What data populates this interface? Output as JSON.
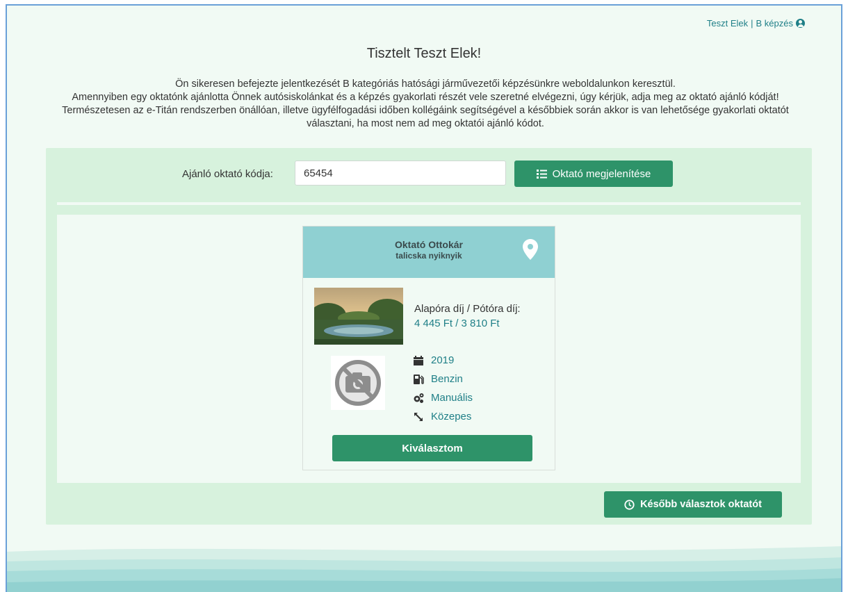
{
  "header": {
    "user_name": "Teszt Elek",
    "separator": "|",
    "course": "B képzés",
    "icon": "user-circle-icon"
  },
  "greeting": "Tisztelt Teszt Elek!",
  "intro": {
    "line1": "Ön sikeresen befejezte jelentkezését B kategóriás hatósági járművezetői képzésünkre weboldalunkon keresztül.",
    "line2": "Amennyiben egy oktatónk ajánlotta Önnek autósiskolánkat és a képzés gyakorlati részét vele szeretné elvégezni, úgy kérjük, adja meg az oktató ajánló kódját! Természetesen az e-Titán rendszerben önállóan, illetve ügyfélfogadási időben kollégáink segítségével a későbbiek során akkor is van lehetősége gyakorlati oktatót választani, ha most nem ad meg oktatói ajánló kódot."
  },
  "code_form": {
    "label": "Ajánló oktató kódja:",
    "value": "65454",
    "button_label": "Oktató megjelenítése",
    "button_icon": "list-icon"
  },
  "instructor": {
    "name": "Oktató Ottokár",
    "subtitle": "talicska nyiknyik",
    "fee_label": "Alapóra díj / Pótóra díj:",
    "fee_value": "4 445 Ft / 3 810 Ft",
    "specs": [
      {
        "icon": "calendar-icon",
        "value": "2019"
      },
      {
        "icon": "fuel-pump-icon",
        "value": "Benzin"
      },
      {
        "icon": "gears-icon",
        "value": "Manuális"
      },
      {
        "icon": "resize-icon",
        "value": "Közepes"
      }
    ],
    "choose_label": "Kiválasztom"
  },
  "later_button": {
    "label": "Később választok oktatót",
    "icon": "clock-icon"
  },
  "colors": {
    "accent": "#2e9369",
    "link": "#1f7f87",
    "panel": "#d7f2dd",
    "card_header": "#8fd0d2",
    "background": "#f1faf4"
  }
}
